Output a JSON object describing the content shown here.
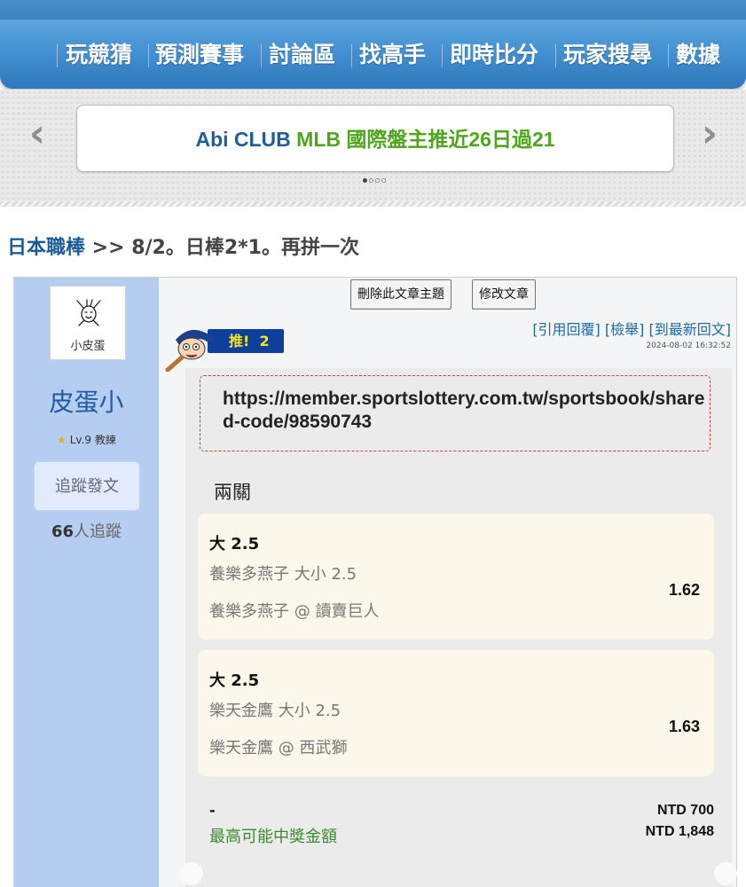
{
  "nav": {
    "items": [
      "玩競猜",
      "預測賽事",
      "討論區",
      "找高手",
      "即時比分",
      "玩家搜尋",
      "數據"
    ]
  },
  "ticker": {
    "part1": "Abi CLUB ",
    "part2": "MLB 國際盤主推近26日過21",
    "prev_icon": "‹",
    "next_icon": "›",
    "page_count": 4,
    "active_page": 1
  },
  "breadcrumb": {
    "category": "日本職棒",
    "separator": " >> ",
    "title": "8/2。日棒2*1。再拼一次"
  },
  "author": {
    "avatar_caption": "小皮蛋",
    "name": "皮蛋小",
    "level": "Lv.9 教練",
    "follow_label": "追蹤發文",
    "follower_count": "66",
    "follower_suffix": "人追蹤"
  },
  "post": {
    "delete_label": "刪除此文章主題",
    "edit_label": "修改文章",
    "push_label": "推!",
    "push_count": "2",
    "action_quote": "[引用回覆]",
    "action_report": "[檢舉]",
    "action_latest": "[到最新回文]",
    "timestamp": "2024-08-02 16:32:52"
  },
  "content": {
    "link": "https://member.sportslottery.com.tw/sportsbook/shared-code/98590743",
    "combo_title": "兩關",
    "picks": [
      {
        "pick": "大 2.5",
        "market": "養樂多燕子 大小 2.5",
        "match": "養樂多燕子 @ 讀賣巨人",
        "odds": "1.62"
      },
      {
        "pick": "大 2.5",
        "market": "樂天金鷹 大小 2.5",
        "match": "樂天金鷹 @ 西武獅",
        "odds": "1.63"
      }
    ],
    "summary_dash": "-",
    "summary_label": "最高可能中獎金額",
    "stake": "NTD 700",
    "payout": "NTD 1,848"
  },
  "colors": {
    "nav_blue": "#3f8ccf",
    "link_blue": "#1c5c96",
    "ticker_green": "#4fa51c",
    "sidebar_blue": "#b6cdf2",
    "card_bg": "#fbf7ea",
    "prize_green": "#3d8a2e"
  }
}
